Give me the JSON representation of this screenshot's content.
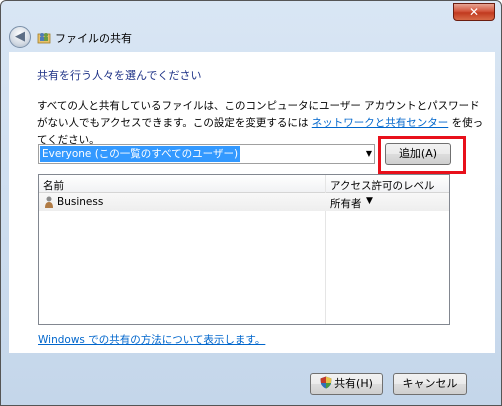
{
  "window": {
    "title": "ファイルの共有",
    "close_glyph": "✕",
    "back_glyph": "◀"
  },
  "main": {
    "heading": "共有を行う人々を選んでください",
    "description_before_link": "すべての人と共有しているファイルは、このコンピュータにユーザー アカウントとパスワードがない人でもアクセスできます。この設定を変更するには ",
    "description_link": "ネットワークと共有センター",
    "description_after_link": " を使ってください。",
    "combo_value": "Everyone (この一覧のすべてのユーザー)",
    "combo_arrow": "▼",
    "add_button": "追加(A)",
    "list": {
      "columns": [
        "名前",
        "アクセス許可のレベル"
      ],
      "rows": [
        {
          "name": "Business",
          "level": "所有者",
          "level_arrow": "▼",
          "icon": "user-icon"
        }
      ]
    },
    "help_link": "Windows での共有の方法について表示します。"
  },
  "footer": {
    "share_button": "共有(H)",
    "cancel_button": "キャンセル"
  },
  "colors": {
    "heading": "#1e3287",
    "link": "#0066cc",
    "highlight": "#e8101b",
    "selection": "#3399ff"
  }
}
